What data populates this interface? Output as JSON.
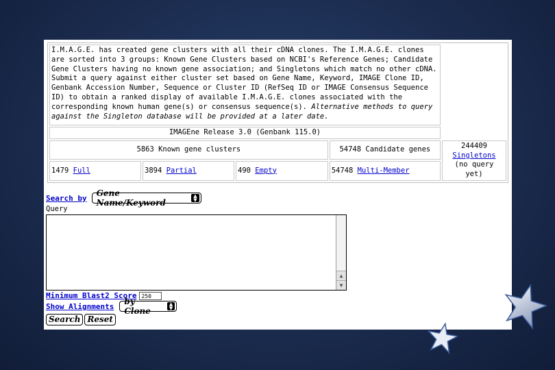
{
  "intro": {
    "text": "I.M.A.G.E. has created gene clusters with all their cDNA clones. The I.M.A.G.E. clones are sorted into 3 groups: Known Gene Clusters based on NCBI's Reference Genes; Candidate Gene Clusters having no known gene association; and Singletons which match no other cDNA. Submit a query against either cluster set based on Gene Name, Keyword, IMAGE Clone ID, Genbank Accession Number, Sequence or Cluster ID (RefSeq ID or IMAGE Consensus Sequence ID) to obtain a ranked display of available I.M.A.G.E. clones associated with the corresponding known human gene(s) or consensus sequence(s).",
    "italic_text": "Alternative methods to query against the Singleton database will be provided at a later date."
  },
  "release": "IMAGEne Release 3.0 (Genbank 115.0)",
  "known": {
    "label": "5863 Known gene clusters",
    "full_count": "1479",
    "full_link": "Full",
    "partial_count": "3894",
    "partial_link": "Partial",
    "empty_count": "490",
    "empty_link": "Empty"
  },
  "candidate": {
    "label": "54748 Candidate genes",
    "multi_count": "54748",
    "multi_link": "Multi-Member"
  },
  "singletons": {
    "count": "244409",
    "link": "Singletons",
    "note": "(no query yet)"
  },
  "form": {
    "search_by_label": "Search by",
    "search_by_value": "Gene Name/Keyword",
    "query_label": "Query",
    "blast_label": "Minimum Blast2 Score",
    "blast_value": "250",
    "alignments_label": "Show Alignments",
    "alignments_value": "by Clone",
    "search_button": "Search",
    "reset_button": "Reset"
  }
}
